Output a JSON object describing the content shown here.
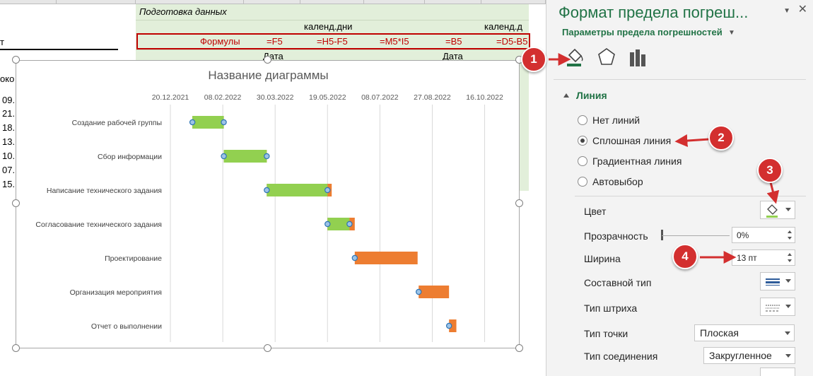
{
  "sheet": {
    "header_cells": {
      "section_title": "Подготовка данных",
      "kalend1": "календ.дни",
      "kalend2": "календ.д",
      "stub": "т",
      "date1": "Дата",
      "date2": "Дата",
      "left_top": "око"
    },
    "formulas": [
      "Формулы",
      "=F5",
      "=H5-F5",
      "=M5*I5",
      "=B5",
      "=D5-B5"
    ],
    "left_numbers": [
      "09.",
      "21.",
      "18.",
      "13.",
      "10.",
      "07.",
      "15."
    ]
  },
  "chart": {
    "title": "Название диаграммы"
  },
  "chart_data": {
    "type": "bar",
    "title": "Название диаграммы",
    "x_ticks": [
      "20.12.2021",
      "08.02.2022",
      "30.03.2022",
      "19.05.2022",
      "08.07.2022",
      "27.08.2022",
      "16.10.2022"
    ],
    "xlim": [
      "2021-12-20",
      "2022-11-15"
    ],
    "categories": [
      "Создание рабочей группы",
      "Сбор информации",
      "Написание технического задания",
      "Согласование технического задания",
      "Проектирование",
      "Организация мероприятия",
      "Отчет о выполнении"
    ],
    "series": [
      {
        "values": [
          [
            "2022-01-10",
            "2022-02-09"
          ],
          [
            "2022-02-09",
            "2022-03-22"
          ],
          [
            "2022-03-22",
            "2022-05-19"
          ],
          [
            "2022-05-19",
            "2022-06-09"
          ],
          [
            "2022-06-14",
            "2022-06-14"
          ],
          [
            "2022-08-29",
            "2022-08-29"
          ],
          [
            "2022-09-28",
            "2022-09-28"
          ]
        ],
        "color": "#92d050"
      },
      {
        "values": [
          [
            "2022-01-10",
            "2022-02-09"
          ],
          [
            "2022-02-09",
            "2022-03-22"
          ],
          [
            "2022-03-22",
            "2022-05-23"
          ],
          [
            "2022-05-19",
            "2022-06-14"
          ],
          [
            "2022-06-14",
            "2022-08-13"
          ],
          [
            "2022-08-14",
            "2022-09-12"
          ],
          [
            "2022-09-12",
            "2022-09-19"
          ]
        ],
        "color": "#ed7d31"
      }
    ],
    "error_bar_markers": [
      [
        "2022-01-10",
        "2022-02-09"
      ],
      [
        "2022-02-09",
        "2022-03-22"
      ],
      [
        "2022-03-22",
        "2022-05-19"
      ],
      [
        "2022-05-19",
        "2022-06-09"
      ],
      [
        "2022-06-14"
      ],
      [
        "2022-08-14"
      ],
      [
        "2022-09-12"
      ]
    ],
    "grid": true
  },
  "pane": {
    "title": "Формат предела погреш...",
    "subtitle": "Параметры предела погрешностей",
    "section": "Линия",
    "radios": [
      {
        "label": "Нет линий",
        "selected": false
      },
      {
        "label": "Сплошная линия",
        "selected": true
      },
      {
        "label": "Градиентная линия",
        "selected": false
      },
      {
        "label": "Автовыбор",
        "selected": false
      }
    ],
    "color_label": "Цвет",
    "transparency_label": "Прозрачность",
    "transparency_value": "0%",
    "width_label": "Ширина",
    "width_value": "13 пт",
    "compound_label": "Составной тип",
    "dash_label": "Тип штриха",
    "cap_label": "Тип точки",
    "cap_value": "Плоская",
    "join_label": "Тип соединения",
    "join_value": "Закругленное",
    "close_icon": "close-icon",
    "accent": "#217346"
  },
  "callouts": [
    "1",
    "2",
    "3",
    "4"
  ],
  "callout_color": "#d32f2f"
}
